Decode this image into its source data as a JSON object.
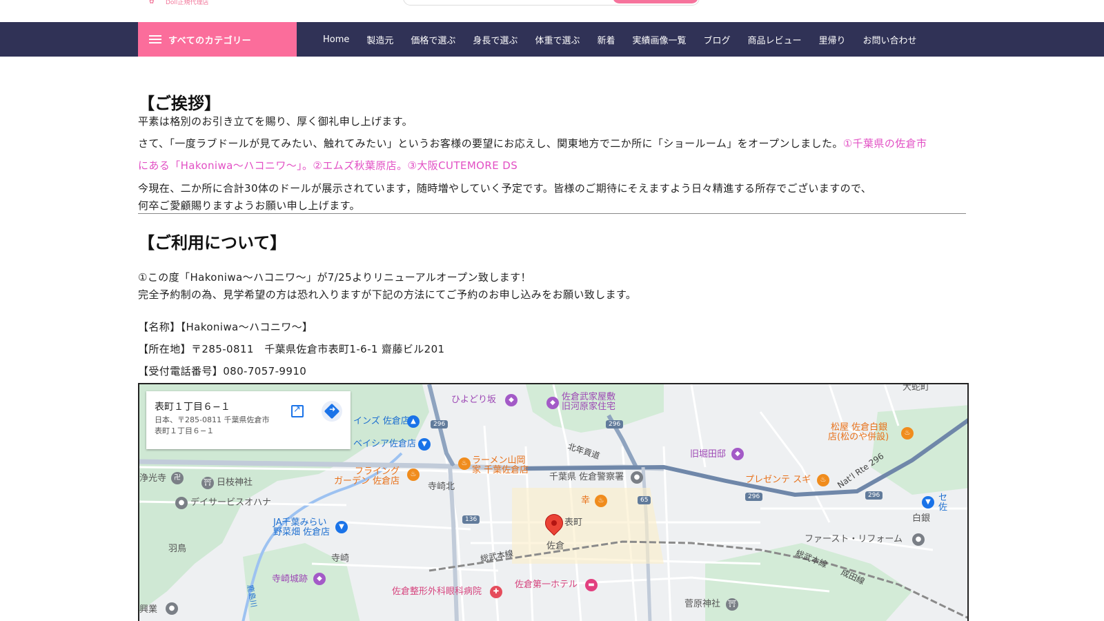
{
  "header": {
    "logo_subtext": "Doll正規代理店",
    "logo_mark": "✿"
  },
  "nav": {
    "category_button": "すべてのカテゴリー",
    "items": [
      "Home",
      "製造元",
      "価格で選ぶ",
      "身長で選ぶ",
      "体重で選ぶ",
      "新着",
      "実績画像一覧",
      "ブログ",
      "商品レビュー",
      "里帰り",
      "お問い合わせ"
    ]
  },
  "greeting": {
    "heading": "【ご挨拶】",
    "line1": "平素は格別のお引き立てを賜り、厚く御礼申し上げます。",
    "line2_plain": "さて、「一度ラブドールが見てみたい、触れてみたい」というお客様の要望にお応えし、関東地方で二か所に「ショールーム」をオープンしました。",
    "line2_link": "①千葉県の佐倉市",
    "line3_link": "にある「Hakoniwa～ハコニワ～」。②エムズ秋葉原店。③大阪CUTEMORE DS",
    "line4": "今現在、二か所に合計30体のドールが展示されています，随時増やしていく予定です。皆様のご期待にそえますよう日々精進する所存でございますので、",
    "line5": "何卒ご愛顧賜りますようお願い申し上げます。"
  },
  "usage": {
    "heading": "【ご利用について】",
    "line1": "①この度「Hakoniwa～ハコニワ～」が7/25よりリニューアルオープン致します！",
    "line2": "完全予約制の為、見学希望の方は恐れ入りますが下記の方法にてご予約のお申し込みをお願い致します。",
    "name_line": "【名称】【Hakoniwa～ハコニワ～】",
    "address_line": "【所在地】〒285-0811　千葉県佐倉市表町1-6-1 齋藤ビル201",
    "phone_line": "【受付電話番号】080-7057-9910"
  },
  "map": {
    "card_title": "表町１丁目６−１",
    "card_address_1": "日本、〒285-0811 千葉県佐倉市",
    "card_address_2": "表町１丁目６−１",
    "labels": {
      "hiyodorizaka": "ひよどり坂",
      "bukeyashiki_1": "佐倉武家屋敷",
      "bukeyashiki_2": "旧河原家住宅",
      "ohebicho": "大蛇町",
      "inns": "インズ 佐倉店",
      "beisia": "ベイシア佐倉店",
      "matsuya_1": "松屋 佐倉白銀",
      "matsuya_2": "店(松のや併設)",
      "kitanenkudo": "北年貢道",
      "kyuhotta": "旧堀田邸",
      "ramen_1": "ラーメン山岡",
      "ramen_2": "家 千葉佐倉店",
      "flying_1": "フライング",
      "flying_2": "ガーデン 佐倉店",
      "terasakikita": "寺崎北",
      "police": "千葉県 佐倉警察署",
      "presente": "プレゼンテ スギ",
      "natl": "Nat'l Rte 296",
      "jokoji": "浄光寺",
      "hiyoshi": "日枝神社",
      "dayservice": "デイサービスオハナ",
      "sachi": "幸",
      "ja_1": "JA千葉みらい",
      "ja_2": "野菜畑 佐倉店",
      "omotemachi": "表町",
      "sakura": "佐倉",
      "shirogane": "白銀",
      "first_reform": "ファースト・リフォーム",
      "hatori": "羽鳥",
      "terasaki": "寺崎",
      "sobu_1": "総武本線",
      "sobu_2": "総武本線",
      "narita": "成田線",
      "terasaki_castle": "寺崎城跡",
      "hospital": "佐倉整形外科眼科病院",
      "hotel": "佐倉第一ホテル",
      "sugawara": "菅原神社",
      "kogyo": "興業",
      "kashima": "鹿島川",
      "se": "セ",
      "sa": "佐"
    },
    "shields": [
      "296",
      "296",
      "296",
      "296",
      "136",
      "65"
    ]
  }
}
